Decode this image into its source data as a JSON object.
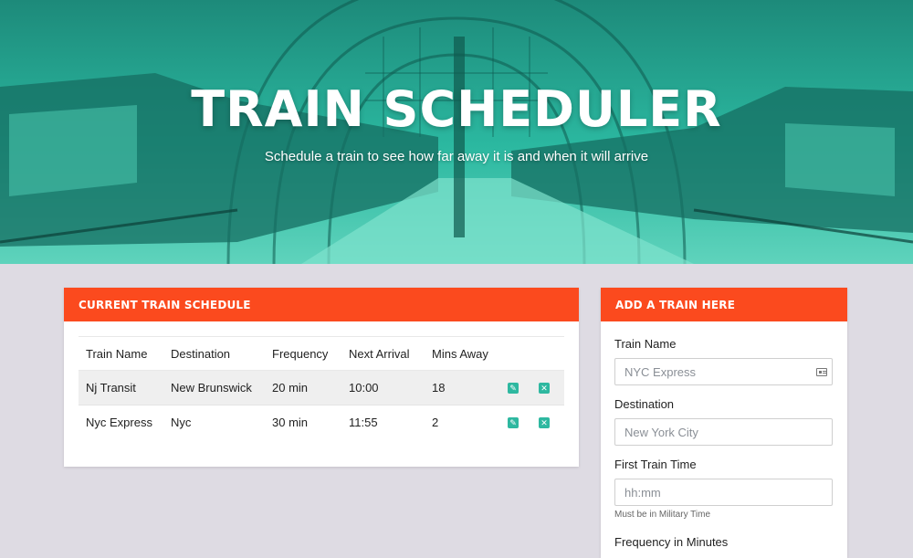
{
  "hero": {
    "title": "TRAIN SCHEDULER",
    "subtitle": "Schedule a train to see how far away it is and when it will arrive",
    "overlay_color": "#2bb8a0"
  },
  "schedule": {
    "heading": "CURRENT TRAIN SCHEDULE",
    "columns": [
      "Train Name",
      "Destination",
      "Frequency",
      "Next Arrival",
      "Mins Away"
    ],
    "rows": [
      {
        "name": "Nj Transit",
        "destination": "New Brunswick",
        "frequency": "20 min",
        "next_arrival": "10:00",
        "mins_away": "18"
      },
      {
        "name": "Nyc Express",
        "destination": "Nyc",
        "frequency": "30 min",
        "next_arrival": "11:55",
        "mins_away": "2"
      }
    ],
    "edit_icon": "pencil-icon",
    "delete_icon": "x-icon"
  },
  "add_train": {
    "heading": "ADD A TRAIN HERE",
    "train_name_label": "Train Name",
    "train_name_placeholder": "NYC Express",
    "destination_label": "Destination",
    "destination_placeholder": "New York City",
    "first_time_label": "First Train Time",
    "first_time_placeholder": "hh:mm",
    "first_time_hint": "Must be in Military Time",
    "frequency_label": "Frequency in Minutes"
  },
  "colors": {
    "accent": "#fb4a1e",
    "teal": "#2eb8a0",
    "background": "#dedbe3"
  }
}
